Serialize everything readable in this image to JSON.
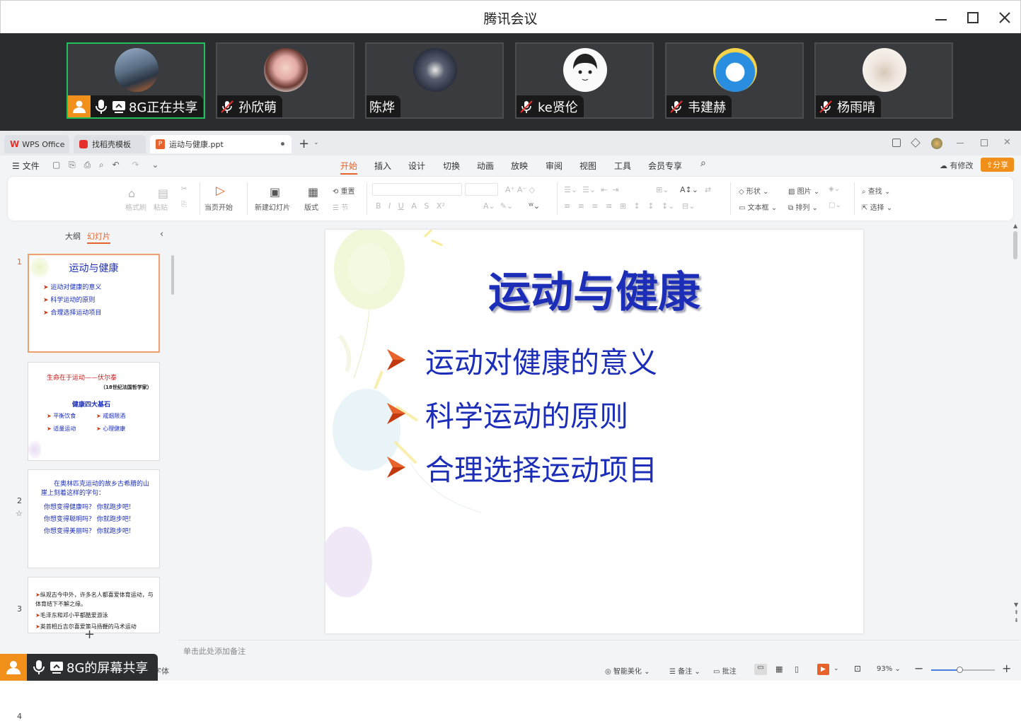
{
  "window": {
    "title": "腾讯会议"
  },
  "participants": [
    {
      "name": "8G正在共享",
      "role": "sharing",
      "mic": "on"
    },
    {
      "name": "孙欣萌",
      "mic": "off"
    },
    {
      "name": "陈烨",
      "mic": "none"
    },
    {
      "name": "ke贤伦",
      "mic": "off"
    },
    {
      "name": "韦建赫",
      "mic": "off"
    },
    {
      "name": "杨雨晴",
      "mic": "off"
    }
  ],
  "wps": {
    "tabs": [
      "WPS Office",
      "找稻壳模板",
      "运动与健康.ppt"
    ],
    "file_menu": "文件",
    "menu_items": [
      "开始",
      "插入",
      "设计",
      "切换",
      "动画",
      "放映",
      "审阅",
      "视图",
      "工具",
      "会员专享"
    ],
    "active_menu": "开始",
    "has_changes": "有修改",
    "share": "分享",
    "ribbon": {
      "format_painter": "格式刷",
      "paste": "粘贴",
      "start_from_current": "当页开始",
      "new_slide": "新建幻灯片",
      "layout": "版式",
      "reset": "重置",
      "section": "节",
      "shape": "形状",
      "picture": "图片",
      "textbox": "文本框",
      "arrange": "排列",
      "find": "查找",
      "select": "选择"
    },
    "panel_tabs": {
      "outline": "大纲",
      "slides": "幻灯片"
    },
    "thumbnails": [
      {
        "num": "1",
        "title": "运动与健康",
        "lines": [
          "运动对健康的意义",
          "科学运动的原则",
          "合理选择运动项目"
        ]
      },
      {
        "num": "2",
        "title": "生命在于运动——伏尔泰",
        "subtitle": "（18世纪法国哲学家）",
        "heading": "健康四大基石",
        "lines": [
          "平衡饮食",
          "戒烟限酒",
          "适量运动",
          "心理健康"
        ]
      },
      {
        "num": "3",
        "lines": [
          "在奥林匹克运动的故乡古希腊的山崖上刻着这样的字句：",
          "你想变得健康吗？ 你就跑步吧!",
          "你想变得聪明吗？ 你就跑步吧!",
          "你想变得美丽吗？ 你就跑步吧!"
        ]
      },
      {
        "num": "4",
        "lines": [
          "纵观古今中外，许多名人都喜爱体育运动，与体育结下不解之缘。",
          "毛泽东和邓小平都酷爱游泳",
          "英首相丘吉尔喜爱策马扬鞭的马术运动"
        ]
      }
    ],
    "slide": {
      "title": "运动与健康",
      "bullets": [
        "运动对健康的意义",
        "科学运动的原则",
        "合理选择运动项目"
      ]
    },
    "notes_placeholder": "单击此处添加备注",
    "status": {
      "font_hint": "字体",
      "beautify": "智能美化",
      "notes": "备注",
      "comments": "批注",
      "zoom": "93%"
    }
  },
  "screen_share_badge": "8G的屏幕共享",
  "colors": {
    "accent": "#f0901a",
    "active_tab": "#e8622c",
    "slide_text": "#1c2eb8",
    "bullet_arrow": "#c43a10",
    "active_border": "#1fc15a"
  }
}
